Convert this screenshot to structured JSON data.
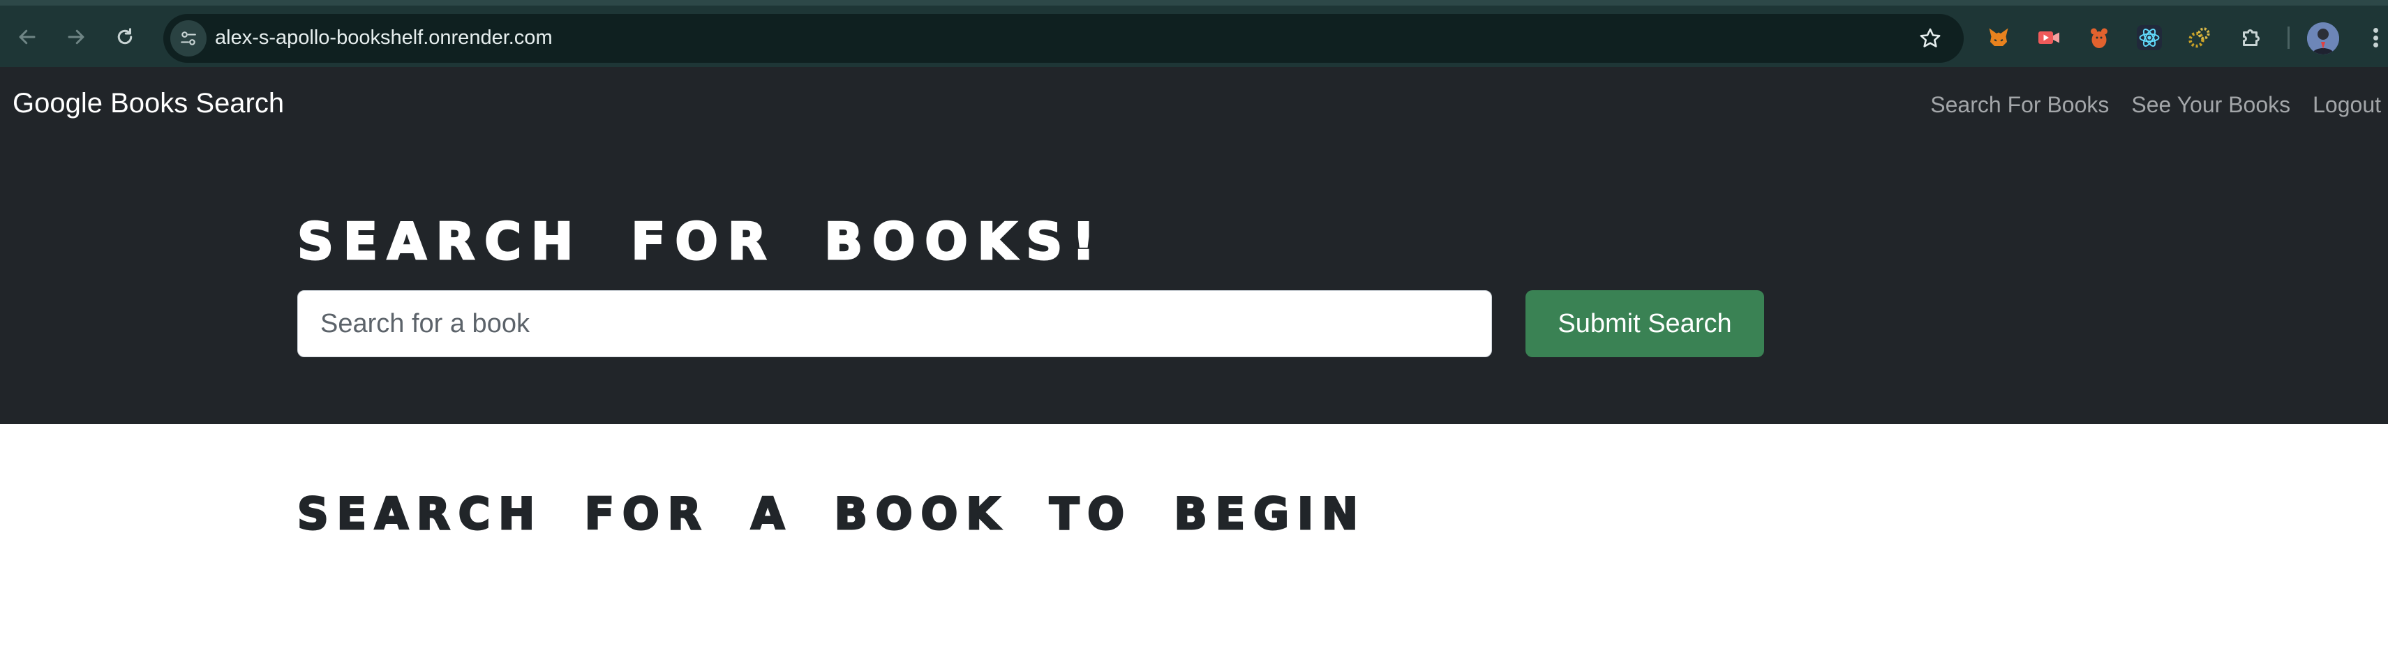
{
  "browser": {
    "url": "alex-s-apollo-bookshelf.onrender.com",
    "icons": {
      "back": "arrow-left-icon",
      "forward": "arrow-right-icon",
      "reload": "reload-icon",
      "site_info": "tune-icon",
      "bookmark": "star-icon",
      "extensions": [
        "metamask-fox-icon",
        "video-play-icon",
        "bear-icon",
        "react-atom-icon",
        "cogs-icon",
        "puzzle-icon"
      ],
      "profile": "avatar",
      "menu": "kebab-icon"
    }
  },
  "navbar": {
    "brand": "Google Books Search",
    "links": [
      "Search For Books",
      "See Your Books",
      "Logout"
    ]
  },
  "hero": {
    "title": "SEARCH FOR BOOKS!",
    "search_placeholder": "Search for a book",
    "search_value": "",
    "submit_label": "Submit Search"
  },
  "main": {
    "heading": "SEARCH FOR A BOOK TO BEGIN"
  },
  "colors": {
    "chrome_bg": "#1e3636",
    "navbar_bg": "#212529",
    "submit_bg": "#3a8254",
    "page_bg": "#ffffff"
  }
}
